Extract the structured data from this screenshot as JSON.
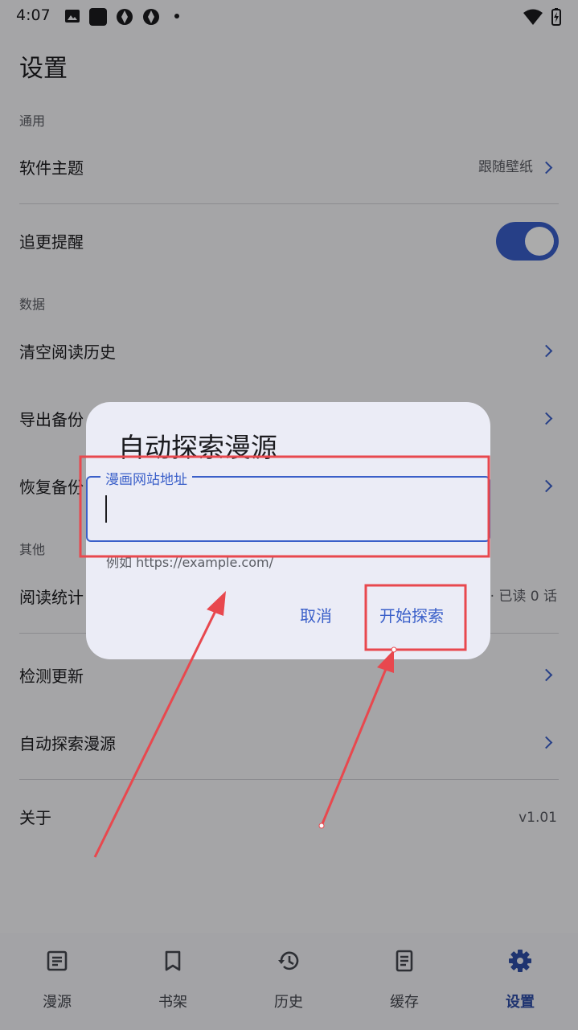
{
  "status_bar": {
    "time": "4:07"
  },
  "page_title": "设置",
  "sections": {
    "general": "通用",
    "data": "数据",
    "other": "其他"
  },
  "rows": {
    "theme": {
      "label": "软件主题",
      "value": "跟随壁纸"
    },
    "update_reminder": {
      "label": "追更提醒",
      "enabled": true
    },
    "clear_history": {
      "label": "清空阅读历史"
    },
    "export_backup": {
      "label": "导出备份"
    },
    "restore_backup": {
      "label": "恢复备份"
    },
    "reading_stats": {
      "label": "阅读统计",
      "value": "· 已读 0 话"
    },
    "check_update": {
      "label": "检测更新"
    },
    "auto_explore": {
      "label": "自动探索漫源"
    },
    "about": {
      "label": "关于",
      "value": "v1.01"
    }
  },
  "dialog": {
    "title": "自动探索漫源",
    "field_label": "漫画网站地址",
    "field_value": "",
    "helper": "例如 https://example.com/",
    "cancel_label": "取消",
    "confirm_label": "开始探索"
  },
  "bottom_nav": [
    {
      "label": "漫源",
      "icon": "list-box-icon",
      "active": false
    },
    {
      "label": "书架",
      "icon": "bookmark-icon",
      "active": false
    },
    {
      "label": "历史",
      "icon": "history-icon",
      "active": false
    },
    {
      "label": "缓存",
      "icon": "document-icon",
      "active": false
    },
    {
      "label": "设置",
      "icon": "gear-icon",
      "active": true
    }
  ],
  "colors": {
    "accent": "#3a5fc9",
    "annotation": "#e8484e"
  }
}
